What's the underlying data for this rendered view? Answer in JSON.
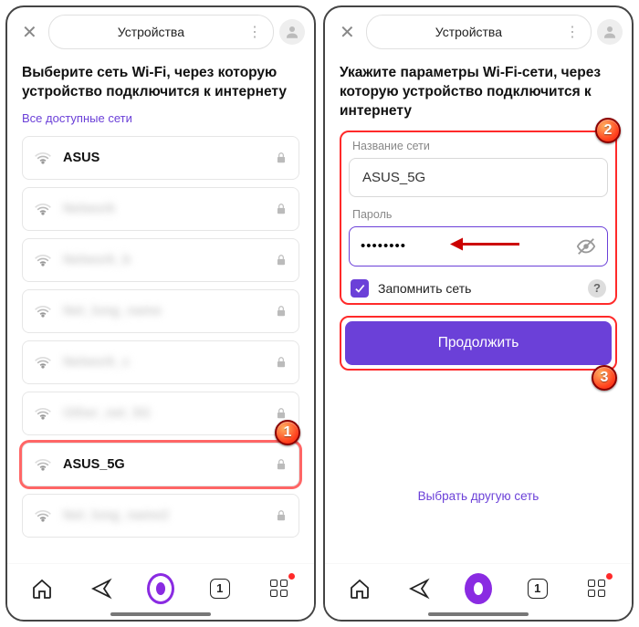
{
  "left": {
    "header_title": "Устройства",
    "heading": "Выберите сеть Wi-Fi, через которую устройство подключится к интернету",
    "all_networks_link": "Все доступные сети",
    "networks": [
      {
        "name": "ASUS",
        "locked": true,
        "blur": false,
        "highlight": false
      },
      {
        "name": "Network",
        "locked": true,
        "blur": true,
        "highlight": false
      },
      {
        "name": "Network_b",
        "locked": true,
        "blur": true,
        "highlight": false
      },
      {
        "name": "Net_long_name",
        "locked": true,
        "blur": true,
        "highlight": false
      },
      {
        "name": "Network_c",
        "locked": true,
        "blur": true,
        "highlight": false
      },
      {
        "name": "Other_net_5G",
        "locked": true,
        "blur": true,
        "highlight": false
      },
      {
        "name": "ASUS_5G",
        "locked": true,
        "blur": false,
        "highlight": true
      },
      {
        "name": "Net_long_name2",
        "locked": true,
        "blur": true,
        "highlight": false
      }
    ],
    "tab_count": "1",
    "badge1": "1"
  },
  "right": {
    "header_title": "Устройства",
    "heading": "Укажите параметры Wi-Fi-сети, через которую устройство подключится к интернету",
    "ssid_label": "Название сети",
    "ssid_value": "ASUS_5G",
    "pw_label": "Пароль",
    "pw_value": "••••••••",
    "remember_label": "Запомнить сеть",
    "continue_label": "Продолжить",
    "other_link": "Выбрать другую сеть",
    "tab_count": "1",
    "badge2": "2",
    "badge3": "3"
  }
}
